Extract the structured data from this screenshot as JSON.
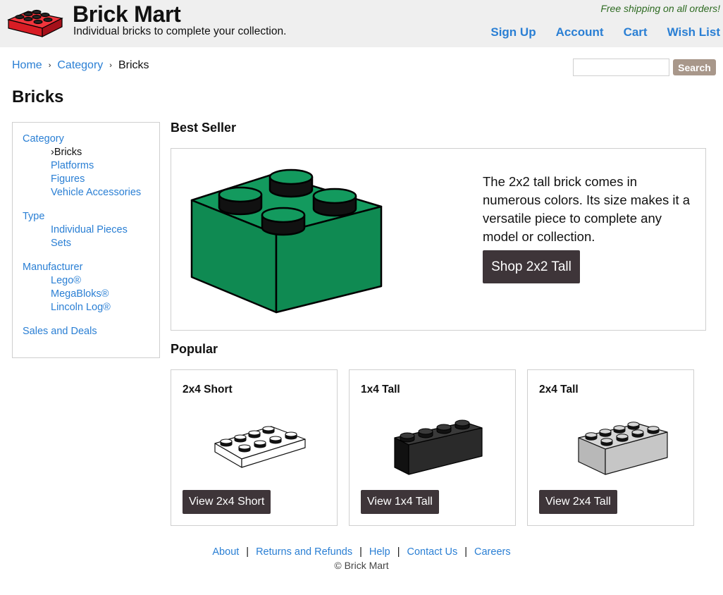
{
  "header": {
    "title": "Brick Mart",
    "tagline": "Individual bricks to complete your collection.",
    "promo": "Free shipping on all orders!",
    "nav": {
      "sign_up": "Sign Up",
      "account": "Account",
      "cart": "Cart",
      "wish_list": "Wish List"
    },
    "logo_icon": "red-brick-logo-icon"
  },
  "breadcrumb": {
    "home": "Home",
    "category": "Category",
    "current": "Bricks",
    "separator": "›"
  },
  "search": {
    "placeholder": "",
    "value": "",
    "button_label": "Search"
  },
  "page_title": "Bricks",
  "sidebar": {
    "category": {
      "label": "Category",
      "items": [
        {
          "label": "›Bricks"
        },
        {
          "label": "Platforms"
        },
        {
          "label": "Figures"
        },
        {
          "label": "Vehicle Accessories"
        }
      ]
    },
    "type": {
      "label": "Type",
      "items": [
        {
          "label": "Individual Pieces"
        },
        {
          "label": "Sets"
        }
      ]
    },
    "manufacturer": {
      "label": "Manufacturer",
      "items": [
        {
          "label": "Lego®"
        },
        {
          "label": "MegaBloks®"
        },
        {
          "label": "Lincoln Log®"
        }
      ]
    },
    "sales": {
      "label": "Sales and Deals"
    }
  },
  "best_seller": {
    "heading": "Best Seller",
    "description": "The 2x2 tall brick comes in numerous colors. Its size makes it a versatile piece to complete any model or collection.",
    "button_label": "Shop 2x2 Tall",
    "brick_color": "#118a55",
    "image_icon": "green-2x2-brick-icon"
  },
  "popular": {
    "heading": "Popular",
    "items": [
      {
        "title": "2x4 Short",
        "button_label": "View 2x4 Short",
        "color": "#ffffff",
        "icon": "white-2x4-short-brick-icon"
      },
      {
        "title": "1x4 Tall",
        "button_label": "View 1x4 Tall",
        "color": "#2a2a2a",
        "icon": "black-1x4-tall-brick-icon"
      },
      {
        "title": "2x4 Tall",
        "button_label": "View 2x4 Tall",
        "color": "#c4c4c4",
        "icon": "gray-2x4-tall-brick-icon"
      }
    ]
  },
  "footer": {
    "links": {
      "about": "About",
      "returns": "Returns and Refunds",
      "help": "Help",
      "contact": "Contact Us",
      "careers": "Careers"
    },
    "separator": "|",
    "copyright": "© Brick Mart"
  },
  "colors": {
    "link": "#2a7fd4",
    "header_bg": "#efefef",
    "promo": "#2e6b22",
    "dark_button": "#3e3539",
    "search_button": "#a8978a",
    "logo_red": "#e8212b"
  }
}
